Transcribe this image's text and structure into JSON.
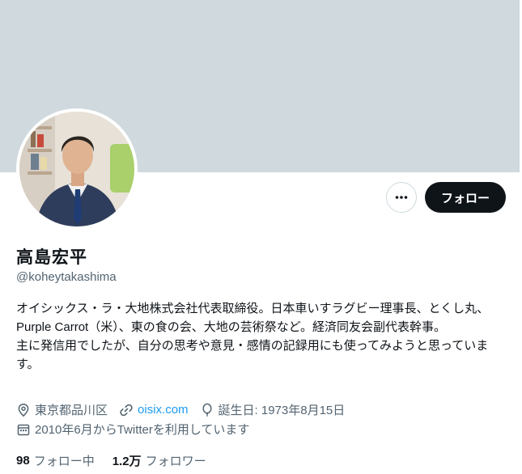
{
  "profile": {
    "name": "高島宏平",
    "handle": "@koheytakashima",
    "bio": "オイシックス・ラ・大地株式会社代表取締役。日本車いすラグビー理事長、とくし丸、Purple Carrot（米）、東の食の会、大地の芸術祭など。経済同友会副代表幹事。\n主に発信用でしたが、自分の思考や意見・感情の記録用にも使ってみようと思っています。",
    "location": "東京都品川区",
    "website": "oisix.com",
    "birthday": "誕生日: 1973年8月15日",
    "joined": "2010年6月からTwitterを利用しています"
  },
  "actions": {
    "follow_label": "フォロー",
    "more_icon": "more-icon"
  },
  "stats": {
    "following_count": "98",
    "following_label": "フォロー中",
    "followers_count": "1.2万",
    "followers_label": "フォロワー"
  },
  "colors": {
    "banner": "#cfd9de",
    "follow_button": "#0f1419",
    "link": "#1d9bf0",
    "secondary_text": "#536471"
  }
}
